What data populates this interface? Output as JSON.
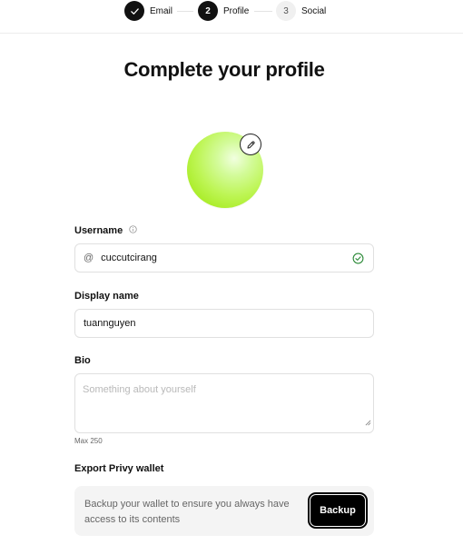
{
  "stepper": {
    "steps": [
      {
        "number": "",
        "label": "Email",
        "state": "done"
      },
      {
        "number": "2",
        "label": "Profile",
        "state": "active"
      },
      {
        "number": "3",
        "label": "Social",
        "state": "pending"
      }
    ]
  },
  "title": "Complete your profile",
  "avatar": {
    "edit_icon": "pencil-icon",
    "gradient_colors": [
      "#f1ffe0",
      "#bdf553",
      "#9ee11a"
    ]
  },
  "username": {
    "label": "Username",
    "prefix": "@",
    "value": "cuccutcirang",
    "status_icon": "check-circle-icon",
    "status_color": "#2e8b3a"
  },
  "display_name": {
    "label": "Display name",
    "value": "tuannguyen"
  },
  "bio": {
    "label": "Bio",
    "placeholder": "Something about yourself",
    "hint": "Max 250"
  },
  "export": {
    "label": "Export Privy wallet",
    "description": "Backup your wallet to ensure you always have access to its contents",
    "button_label": "Backup"
  }
}
